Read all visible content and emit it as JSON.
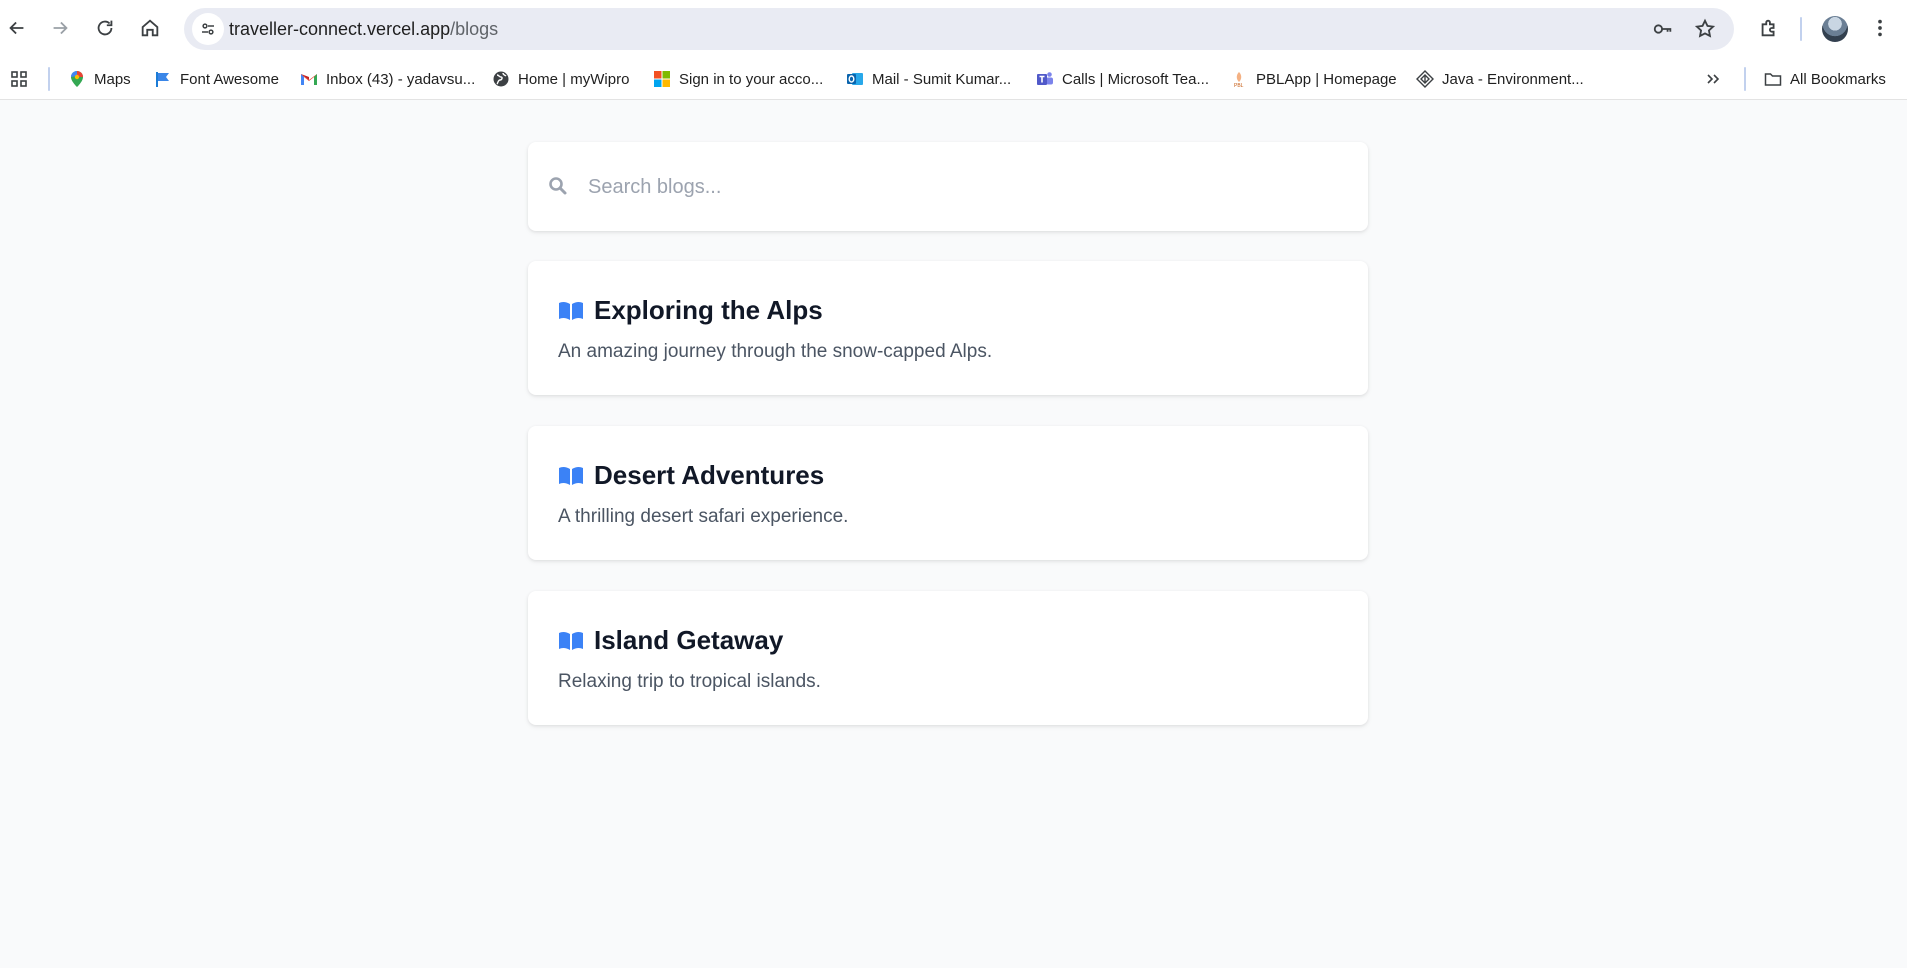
{
  "browser": {
    "url_host": "traveller-connect.vercel.app",
    "url_path": "/blogs"
  },
  "bookmarks": {
    "items": [
      {
        "label": "Maps",
        "icon": "maps-icon"
      },
      {
        "label": "Font Awesome",
        "icon": "font-awesome-flag-icon"
      },
      {
        "label": "Inbox (43) - yadavsu...",
        "icon": "gmail-icon"
      },
      {
        "label": "Home | myWipro",
        "icon": "globe-icon"
      },
      {
        "label": "Sign in to your acco...",
        "icon": "microsoft-icon"
      },
      {
        "label": "Mail - Sumit Kumar...",
        "icon": "outlook-icon"
      },
      {
        "label": "Calls | Microsoft Tea...",
        "icon": "teams-icon"
      },
      {
        "label": "PBLApp | Homepage",
        "icon": "pblapp-icon"
      },
      {
        "label": "Java - Environment...",
        "icon": "java-env-icon"
      }
    ],
    "all_bookmarks_label": "All Bookmarks"
  },
  "search": {
    "placeholder": "Search blogs...",
    "value": ""
  },
  "blogs": [
    {
      "title": "Exploring the Alps",
      "description": "An amazing journey through the snow-capped Alps."
    },
    {
      "title": "Desert Adventures",
      "description": "A thrilling desert safari experience."
    },
    {
      "title": "Island Getaway",
      "description": "Relaxing trip to tropical islands."
    }
  ],
  "colors": {
    "accent": "#3b82f6",
    "page_bg": "#f9fafb",
    "title_text": "#111827",
    "desc_text": "#4b5563"
  }
}
